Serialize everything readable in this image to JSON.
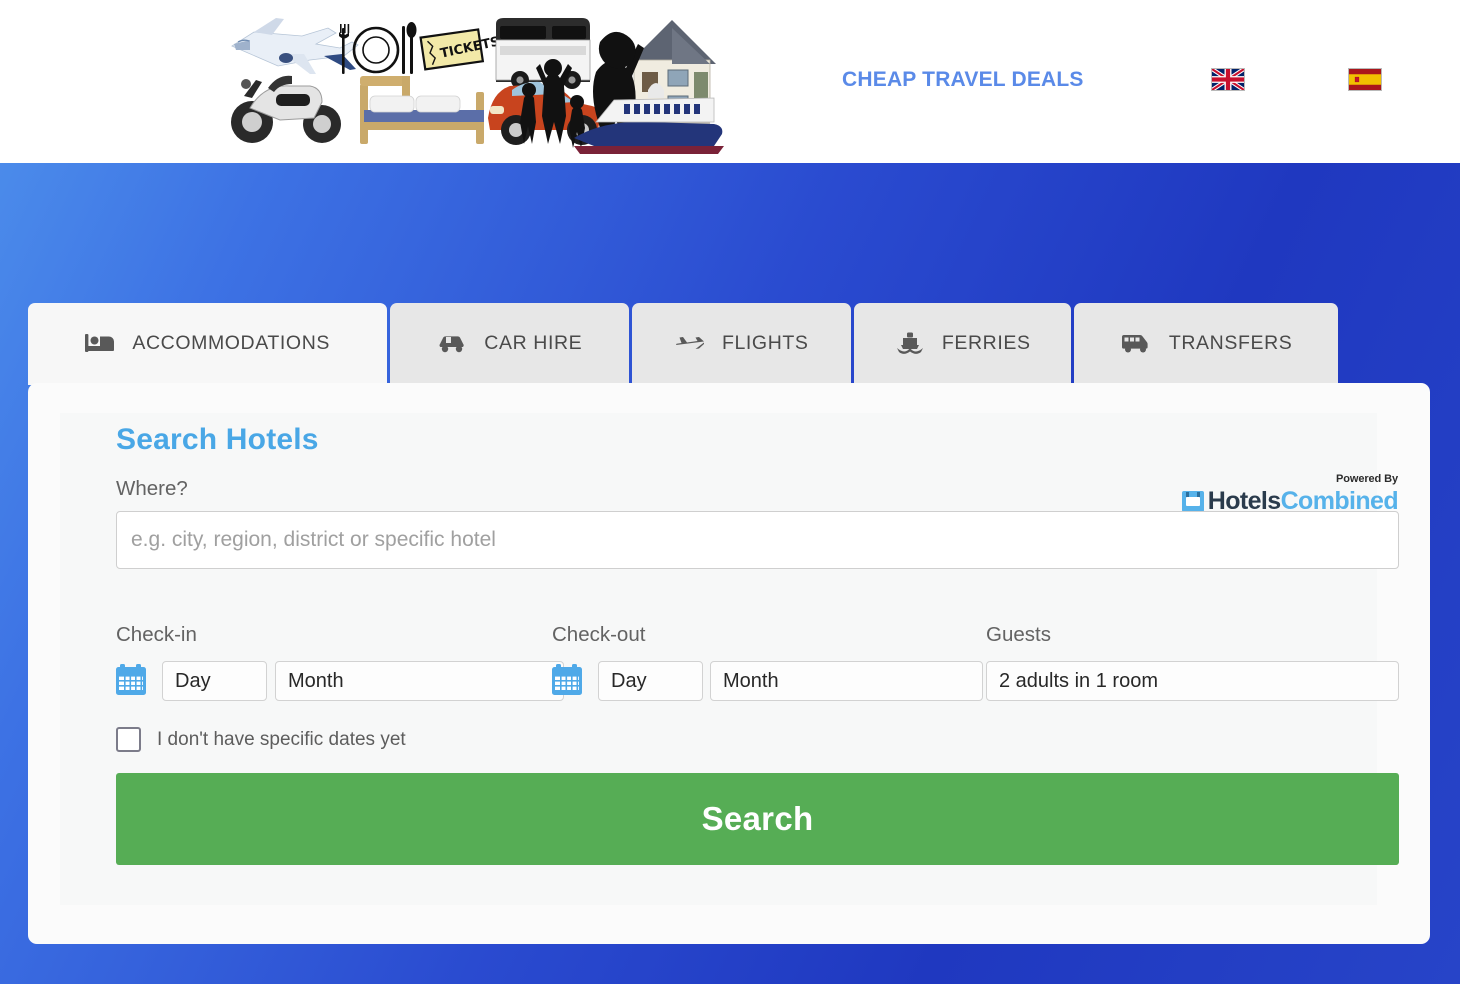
{
  "header": {
    "brand_text": "CHEAP TRAVEL DEALS",
    "collage_alt": "travel-collage",
    "languages": [
      {
        "name": "english",
        "icon": "uk-flag-icon"
      },
      {
        "name": "spanish",
        "icon": "spain-flag-icon"
      }
    ]
  },
  "tabs": [
    {
      "label": "ACCOMMODATIONS",
      "icon": "bed-icon",
      "active": true
    },
    {
      "label": "CAR HIRE",
      "icon": "car-icon",
      "active": false
    },
    {
      "label": "FLIGHTS",
      "icon": "plane-icon",
      "active": false
    },
    {
      "label": "FERRIES",
      "icon": "ferry-icon",
      "active": false
    },
    {
      "label": "TRANSFERS",
      "icon": "van-icon",
      "active": false
    }
  ],
  "form": {
    "title": "Search Hotels",
    "powered_by": "Powered By",
    "provider_name_a": "Hotels",
    "provider_name_b": "Combined",
    "where_label": "Where?",
    "where_placeholder": "e.g. city, region, district or specific hotel",
    "where_value": "",
    "checkin_label": "Check-in",
    "checkout_label": "Check-out",
    "guests_label": "Guests",
    "checkin_day": "Day",
    "checkin_month": "Month",
    "checkout_day": "Day",
    "checkout_month": "Month",
    "guests_value": "2 adults in 1 room",
    "no_dates_label": "I don't have specific dates yet",
    "no_dates_checked": false,
    "search_button": "Search"
  },
  "colors": {
    "accent_blue": "#49a7e6",
    "brand_blue": "#5a8ae8",
    "search_green": "#56ad55",
    "background_blue": "#2a4bd0",
    "tab_active": "#f7f7f7",
    "tab_inactive": "#e7e7e7"
  }
}
